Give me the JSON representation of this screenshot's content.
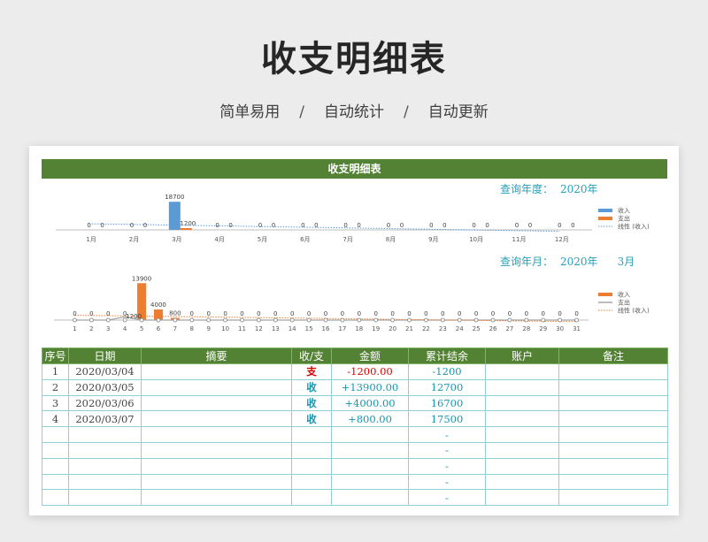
{
  "title": "收支明细表",
  "subtitle": [
    "简单易用",
    "自动统计",
    "自动更新"
  ],
  "subtitle_sep": "/",
  "banner": "收支明细表",
  "year_query": {
    "label": "查询年度：",
    "value": "2020年"
  },
  "month_query": {
    "label": "查询年月：",
    "year": "2020年",
    "month": "3月"
  },
  "colors": {
    "income": "#5b9bd5",
    "expense": "#ed7d31",
    "header": "#548235",
    "accent": "#2aa0b8"
  },
  "chart_data": [
    {
      "type": "bar",
      "categories": [
        "1月",
        "2月",
        "3月",
        "4月",
        "5月",
        "6月",
        "7月",
        "8月",
        "9月",
        "10月",
        "11月",
        "12月"
      ],
      "series": [
        {
          "name": "收入",
          "values": [
            0,
            0,
            18700,
            0,
            0,
            0,
            0,
            0,
            0,
            0,
            0,
            0
          ],
          "labels": [
            "0",
            "0",
            "18700",
            "0",
            "0",
            "0",
            "0",
            "0",
            "0",
            "0",
            "0",
            "0"
          ]
        },
        {
          "name": "支出",
          "values": [
            0,
            0,
            1200,
            0,
            0,
            0,
            0,
            0,
            0,
            0,
            0,
            0
          ],
          "labels": [
            "0",
            "0",
            "1200",
            "0",
            "0",
            "0",
            "0",
            "0",
            "0",
            "0",
            "0",
            "0"
          ]
        }
      ],
      "trendline": "线性 (收入)",
      "ylim": [
        0,
        20000
      ]
    },
    {
      "type": "bar",
      "categories": [
        "1",
        "2",
        "3",
        "4",
        "5",
        "6",
        "7",
        "8",
        "9",
        "10",
        "11",
        "12",
        "13",
        "14",
        "15",
        "16",
        "17",
        "18",
        "19",
        "20",
        "21",
        "22",
        "23",
        "24",
        "25",
        "26",
        "27",
        "28",
        "29",
        "30",
        "31"
      ],
      "series": [
        {
          "name": "收入",
          "values": [
            0,
            0,
            0,
            0,
            13900,
            4000,
            800,
            0,
            0,
            0,
            0,
            0,
            0,
            0,
            0,
            0,
            0,
            0,
            0,
            0,
            0,
            0,
            0,
            0,
            0,
            0,
            0,
            0,
            0,
            0,
            0
          ]
        },
        {
          "name": "支出",
          "values": [
            0,
            0,
            0,
            1200,
            0,
            0,
            0,
            0,
            0,
            0,
            0,
            0,
            0,
            0,
            0,
            0,
            0,
            0,
            0,
            0,
            0,
            0,
            0,
            0,
            0,
            0,
            0,
            0,
            0,
            0,
            0
          ]
        }
      ],
      "point_labels": [
        "0",
        "0",
        "0",
        "0",
        "13900",
        "4000",
        "800",
        "0",
        "0",
        "0",
        "0",
        "0",
        "0",
        "0",
        "0",
        "0",
        "0",
        "0",
        "0",
        "0",
        "0",
        "0",
        "0",
        "0",
        "0",
        "0",
        "0",
        "0",
        "0",
        "0",
        "0"
      ],
      "expense_label": {
        "day": 4,
        "text": "1200"
      },
      "trendline": "线性 (收入)",
      "ylim": [
        0,
        15000
      ]
    }
  ],
  "table": {
    "headers": [
      "序号",
      "日期",
      "摘要",
      "收/支",
      "金额",
      "累计结余",
      "账户",
      "备注"
    ],
    "rows": [
      {
        "no": "1",
        "date": "2020/03/04",
        "summary": "",
        "type": "支",
        "amount": "-1200.00",
        "balance": "-1200",
        "account": "",
        "note": ""
      },
      {
        "no": "2",
        "date": "2020/03/05",
        "summary": "",
        "type": "收",
        "amount": "+13900.00",
        "balance": "12700",
        "account": "",
        "note": ""
      },
      {
        "no": "3",
        "date": "2020/03/06",
        "summary": "",
        "type": "收",
        "amount": "+4000.00",
        "balance": "16700",
        "account": "",
        "note": ""
      },
      {
        "no": "4",
        "date": "2020/03/07",
        "summary": "",
        "type": "收",
        "amount": "+800.00",
        "balance": "17500",
        "account": "",
        "note": ""
      },
      {
        "no": "",
        "date": "",
        "summary": "",
        "type": "",
        "amount": "",
        "balance": "-",
        "account": "",
        "note": ""
      },
      {
        "no": "",
        "date": "",
        "summary": "",
        "type": "",
        "amount": "",
        "balance": "-",
        "account": "",
        "note": ""
      },
      {
        "no": "",
        "date": "",
        "summary": "",
        "type": "",
        "amount": "",
        "balance": "-",
        "account": "",
        "note": ""
      },
      {
        "no": "",
        "date": "",
        "summary": "",
        "type": "",
        "amount": "",
        "balance": "-",
        "account": "",
        "note": ""
      },
      {
        "no": "",
        "date": "",
        "summary": "",
        "type": "",
        "amount": "",
        "balance": "-",
        "account": "",
        "note": ""
      }
    ]
  }
}
